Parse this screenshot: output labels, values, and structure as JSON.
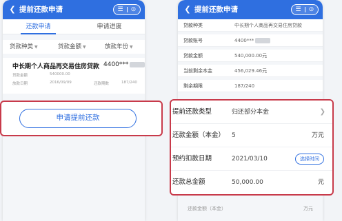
{
  "left_screen": {
    "title": "提前还款申请",
    "capsule": {
      "menu": "☰",
      "close": "⊙"
    },
    "tabs": [
      {
        "label": "还款申请",
        "active": true
      },
      {
        "label": "申请进度",
        "active": false
      }
    ],
    "filters": [
      {
        "label": "贷款种类"
      },
      {
        "label": "贷款金额"
      },
      {
        "label": "放款年份"
      }
    ],
    "loan": {
      "name": "中长期个人商品再交易住房贷款",
      "account": "4400***",
      "rows": [
        {
          "k1": "贷款金额",
          "v1": "540000.00",
          "k2": "",
          "v2": ""
        },
        {
          "k1": "放款日期",
          "v1": "2016/09/09",
          "k2": "还款期数",
          "v2": "187/240"
        }
      ]
    },
    "apply_button": "申请提前还款"
  },
  "right_screen": {
    "title": "提前还款申请",
    "capsule": {
      "menu": "☰",
      "close": "⊙"
    },
    "details": [
      {
        "label": "贷款种类",
        "value": "中长期个人商品再交易住房贷款"
      },
      {
        "label": "贷款账号",
        "value": "4400***"
      },
      {
        "label": "贷款金额",
        "value": "540,000.00元"
      },
      {
        "label": "当前剩余本金",
        "value": "456,029.46元"
      },
      {
        "label": "剩余期限",
        "value": "187/240"
      }
    ],
    "form": {
      "type": {
        "label": "提前还款类型",
        "value": "归还部分本金"
      },
      "principal": {
        "label": "还款金额（本金）",
        "value": "5",
        "unit": "万元"
      },
      "date": {
        "label": "预约扣款日期",
        "value": "2021/03/10",
        "button": "选择时间"
      },
      "total": {
        "label": "还款总金额",
        "value": "50,000.00",
        "unit": "元"
      }
    },
    "footer": {
      "label": "还款金额（本金）",
      "unit": "万元"
    }
  },
  "colors": {
    "primary": "#2f6fe0",
    "highlight": "#c83a4a"
  }
}
